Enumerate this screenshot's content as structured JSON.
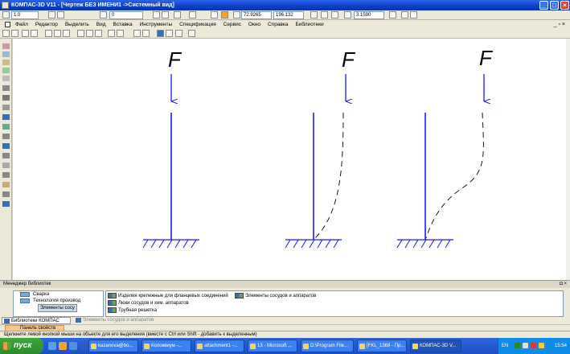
{
  "window": {
    "title": "КОМПАС-3D V11 - [Чертеж БЕЗ ИМЕНИ1 ->Системный вид]"
  },
  "toolbar1": {
    "scale": "1.0",
    "layer": "0",
    "coord_x": "72.9265",
    "coord_y": "196.132",
    "zoom": "3.1590"
  },
  "menu": {
    "items": [
      "Файл",
      "Редактор",
      "Выделить",
      "Вид",
      "Вставка",
      "Инструменты",
      "Спецификация",
      "Сервис",
      "Окно",
      "Справка",
      "Библиотеки"
    ]
  },
  "drawing": {
    "force_label": "F",
    "panels": 3
  },
  "library_manager": {
    "title": "Менеджер библиотек",
    "tree_items": [
      "Сварка",
      "Технология производ",
      "Элементы сосу"
    ],
    "elements": [
      "Изделия крепежные для фланцевых соединений",
      "Элементы сосудов и аппаратов",
      "Люки сосудов и хим. аппаратов",
      "Трубная решетка"
    ],
    "tabs": [
      "Библиотеки КОМПАС",
      "Элементы сосудов и аппаратов"
    ]
  },
  "property_panel": {
    "label": "Панель свойств"
  },
  "status": {
    "text": "Щелкните левой кнопкой мыши на объекте для его выделения (вместе с Ctrl или Shift - добавить к выделенным)"
  },
  "taskbar": {
    "start_label": "пуск",
    "tasks": [
      "kazanova@bo...",
      "Колоквиум -...",
      "attachment1 -...",
      "13 - Microsoft ...",
      "D:\\Program File...",
      "[FKL_1368 - Пр...",
      "КОМПАС-3D V..."
    ],
    "lang": "EN",
    "clock": "15:54"
  },
  "colors": {
    "drawing_blue": "#1a1aff",
    "title_blue": "#0a3fc9",
    "taskbar_blue": "#245edb"
  }
}
